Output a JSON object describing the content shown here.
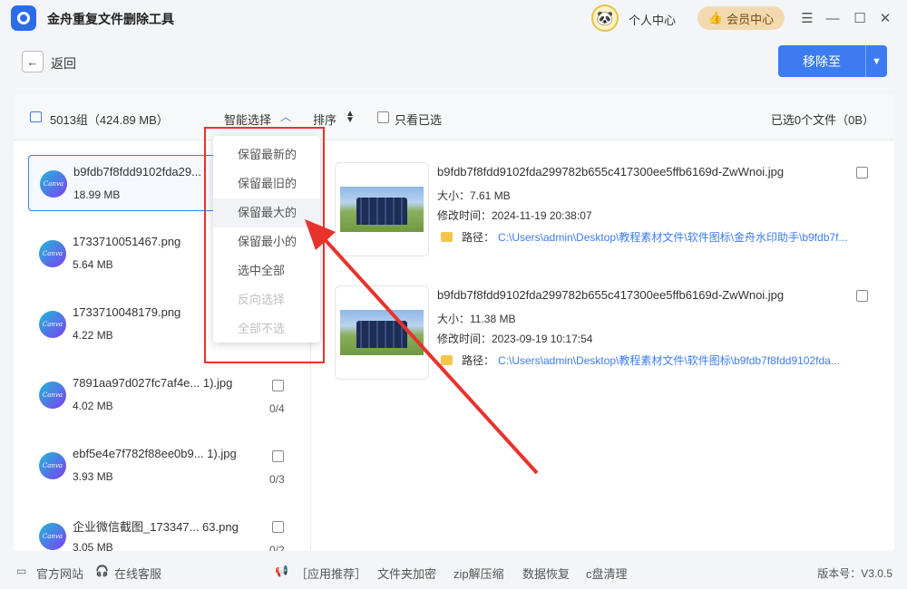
{
  "app": {
    "title": "金舟重复文件删除工具",
    "profile": "个人中心",
    "member": "会员中心"
  },
  "nav": {
    "back": "返回",
    "move_to": "移除至"
  },
  "toolbar": {
    "groups": "5013组（424.89 MB）",
    "smart_select": "智能选择",
    "sort": "排序",
    "only_selected": "只看已选",
    "selected_info": "已选0个文件（0B）"
  },
  "groups": [
    {
      "name": "b9fdb7f8fdd9102fda29...",
      "size": "18.99 MB",
      "count": ""
    },
    {
      "name": "1733710051467.png",
      "size": "5.64 MB",
      "count": ""
    },
    {
      "name": "1733710048179.png",
      "size": "4.22 MB",
      "count": ""
    },
    {
      "name": "7891aa97d027fc7af4e... 1).jpg",
      "size": "4.02 MB",
      "count": "0/4"
    },
    {
      "name": "ebf5e4e7f782f88ee0b9... 1).jpg",
      "size": "3.93 MB",
      "count": "0/3"
    },
    {
      "name": "企业微信截图_173347... 63.png",
      "size": "3.05 MB",
      "count": "0/2"
    }
  ],
  "canva_label": "Canva",
  "files": [
    {
      "name": "b9fdb7f8fdd9102fda299782b655c417300ee5ffb6169d-ZwWnoi.jpg",
      "size": "大小：7.61 MB",
      "mtime": "修改时间：2024-11-19 20:38:07",
      "path_label": "路径：",
      "path": "C:\\Users\\admin\\Desktop\\教程素材文件\\软件图标\\金舟水印助手\\b9fdb7f..."
    },
    {
      "name": "b9fdb7f8fdd9102fda299782b655c417300ee5ffb6169d-ZwWnoi.jpg",
      "size": "大小：11.38 MB",
      "mtime": "修改时间：2023-09-19 10:17:54",
      "path_label": "路径：",
      "path": "C:\\Users\\admin\\Desktop\\教程素材文件\\软件图标\\b9fdb7f8fdd9102fda..."
    }
  ],
  "dropdown": [
    "保留最新的",
    "保留最旧的",
    "保留最大的",
    "保留最小的",
    "选中全部",
    "反向选择",
    "全部不选"
  ],
  "footer": {
    "website": "官方网站",
    "support": "在线客服",
    "recommend": "［应用推荐］",
    "encrypt": "文件夹加密",
    "zip": "zip解压缩",
    "recover": "数据恢复",
    "cclean": "c盘清理",
    "version": "版本号：V3.0.5"
  },
  "colors": {
    "accent": "#3c7cf0",
    "annotation": "#e8322c",
    "member_bg": "#f2d9b0"
  }
}
